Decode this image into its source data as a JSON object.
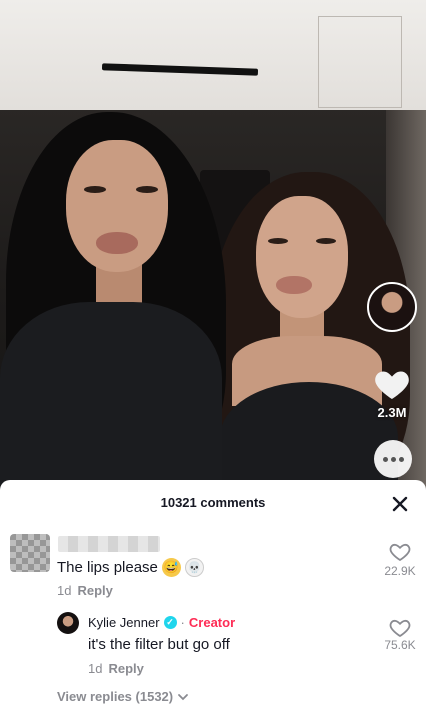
{
  "rail": {
    "like_count": "2.3M"
  },
  "comments_sheet": {
    "title": "10321 comments",
    "comments": [
      {
        "text": "The lips please",
        "age": "1d",
        "reply_label": "Reply",
        "like_count": "22.9K"
      }
    ],
    "creator_reply": {
      "username": "Kylie Jenner",
      "separator": "·",
      "badge": "Creator",
      "text": "it's the filter but go off",
      "age": "1d",
      "reply_label": "Reply",
      "like_count": "75.6K"
    },
    "view_replies": "View replies (1532)"
  },
  "icons": {
    "close": "close-icon",
    "heart": "heart-icon",
    "comment": "comment-icon",
    "verified": "verified-badge-icon",
    "chevron": "chevron-down-icon"
  },
  "colors": {
    "creator_accent": "#fe2c55",
    "verified": "#20d5ec",
    "muted_text": "#8a8b91",
    "primary_text": "#161823"
  }
}
